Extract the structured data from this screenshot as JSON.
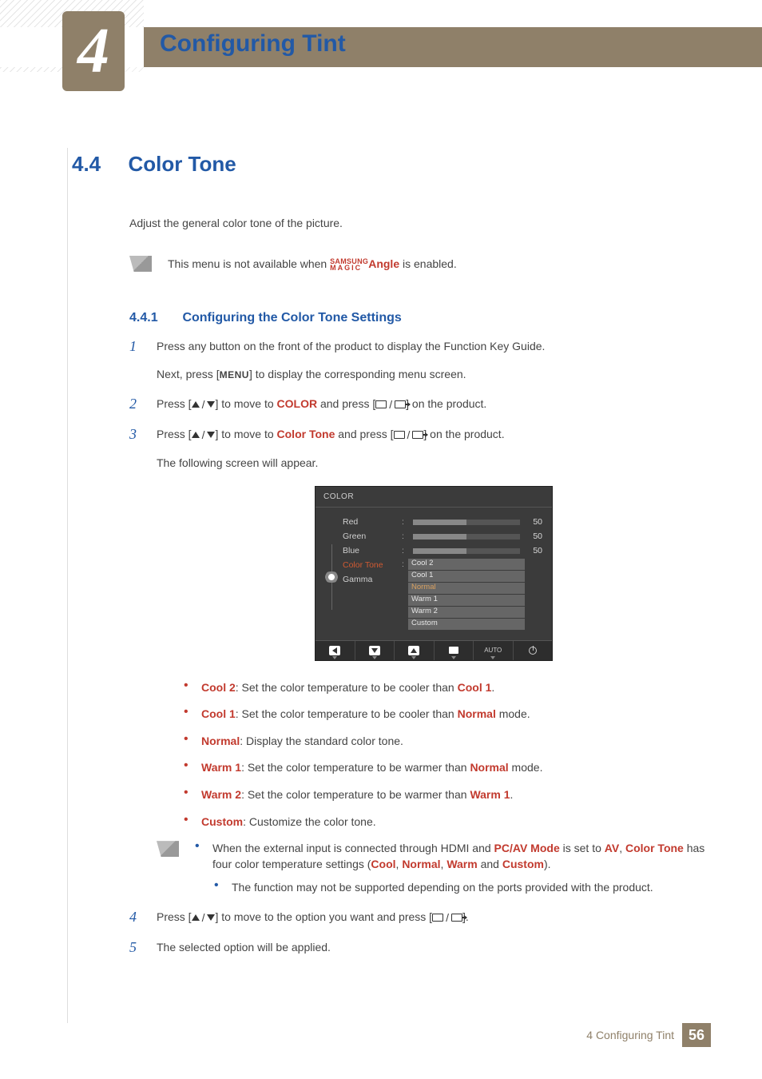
{
  "header": {
    "chapter_num": "4",
    "title": "Configuring Tint"
  },
  "section": {
    "num": "4.4",
    "title": "Color Tone"
  },
  "intro": "Adjust the general color tone of the picture.",
  "avail_note": {
    "pre": "This menu is not available when ",
    "brand1": "SAMSUNG",
    "brand2": "MAGIC",
    "kw": "Angle",
    "post": " is enabled."
  },
  "subsection": {
    "num": "4.4.1",
    "title": "Configuring the Color Tone Settings"
  },
  "steps": {
    "s1": {
      "n": "1",
      "a": "Press any button on the front of the product to display the Function Key Guide.",
      "b_pre": "Next, press [",
      "b_key": "MENU",
      "b_post": "] to display the corresponding menu screen."
    },
    "s2": {
      "n": "2",
      "pre": "Press [",
      "mid": "] to move to ",
      "kw": "COLOR",
      "mid2": " and press [",
      "post": "] on the product."
    },
    "s3": {
      "n": "3",
      "pre": "Press [",
      "mid": "] to move to ",
      "kw": "Color Tone",
      "mid2": " and press [",
      "post": "] on the product.",
      "tail": "The following screen will appear."
    },
    "s4": {
      "n": "4",
      "pre": "Press [",
      "mid": "] to move to the option you want and press [",
      "post": "]."
    },
    "s5": {
      "n": "5",
      "txt": "The selected option will be applied."
    }
  },
  "osd": {
    "title": "COLOR",
    "rows": {
      "r": "Red",
      "g": "Green",
      "b": "Blue",
      "ct": "Color Tone",
      "gm": "Gamma"
    },
    "vals": {
      "r": "50",
      "g": "50",
      "b": "50"
    },
    "opts": {
      "o1": "Cool 2",
      "o2": "Cool 1",
      "o3": "Normal",
      "o4": "Warm 1",
      "o5": "Warm 2",
      "o6": "Custom"
    },
    "auto": "AUTO"
  },
  "options": {
    "o1": {
      "h": "Cool 2",
      "t": ": Set the color temperature to be cooler than ",
      "k": "Cool 1",
      "e": "."
    },
    "o2": {
      "h": "Cool 1",
      "t": ": Set the color temperature to be cooler than ",
      "k": "Normal",
      "e": " mode."
    },
    "o3": {
      "h": "Normal",
      "t": ": Display the standard color tone."
    },
    "o4": {
      "h": "Warm 1",
      "t": ": Set the color temperature to be warmer than ",
      "k": "Normal",
      "e": " mode."
    },
    "o5": {
      "h": "Warm 2",
      "t": ": Set the color temperature to be warmer than ",
      "k": "Warm 1",
      "e": "."
    },
    "o6": {
      "h": "Custom",
      "t": ": Customize the color tone."
    }
  },
  "note2": {
    "l1_a": "When the external input is connected through HDMI and ",
    "l1_k1": "PC/AV Mode",
    "l1_b": " is set to ",
    "l1_k2": "AV",
    "l1_c": ",  ",
    "l1_k3": "Color Tone",
    "l1_d": " has four color temperature settings (",
    "l1_k4": "Cool",
    "l1_e": ", ",
    "l1_k5": "Normal",
    "l1_f": ", ",
    "l1_k6": "Warm",
    "l1_g": " and ",
    "l1_k7": "Custom",
    "l1_h": ").",
    "l2": "The function may not be supported depending on the ports provided with the product."
  },
  "footer": {
    "label": "4 Configuring Tint",
    "page": "56"
  }
}
